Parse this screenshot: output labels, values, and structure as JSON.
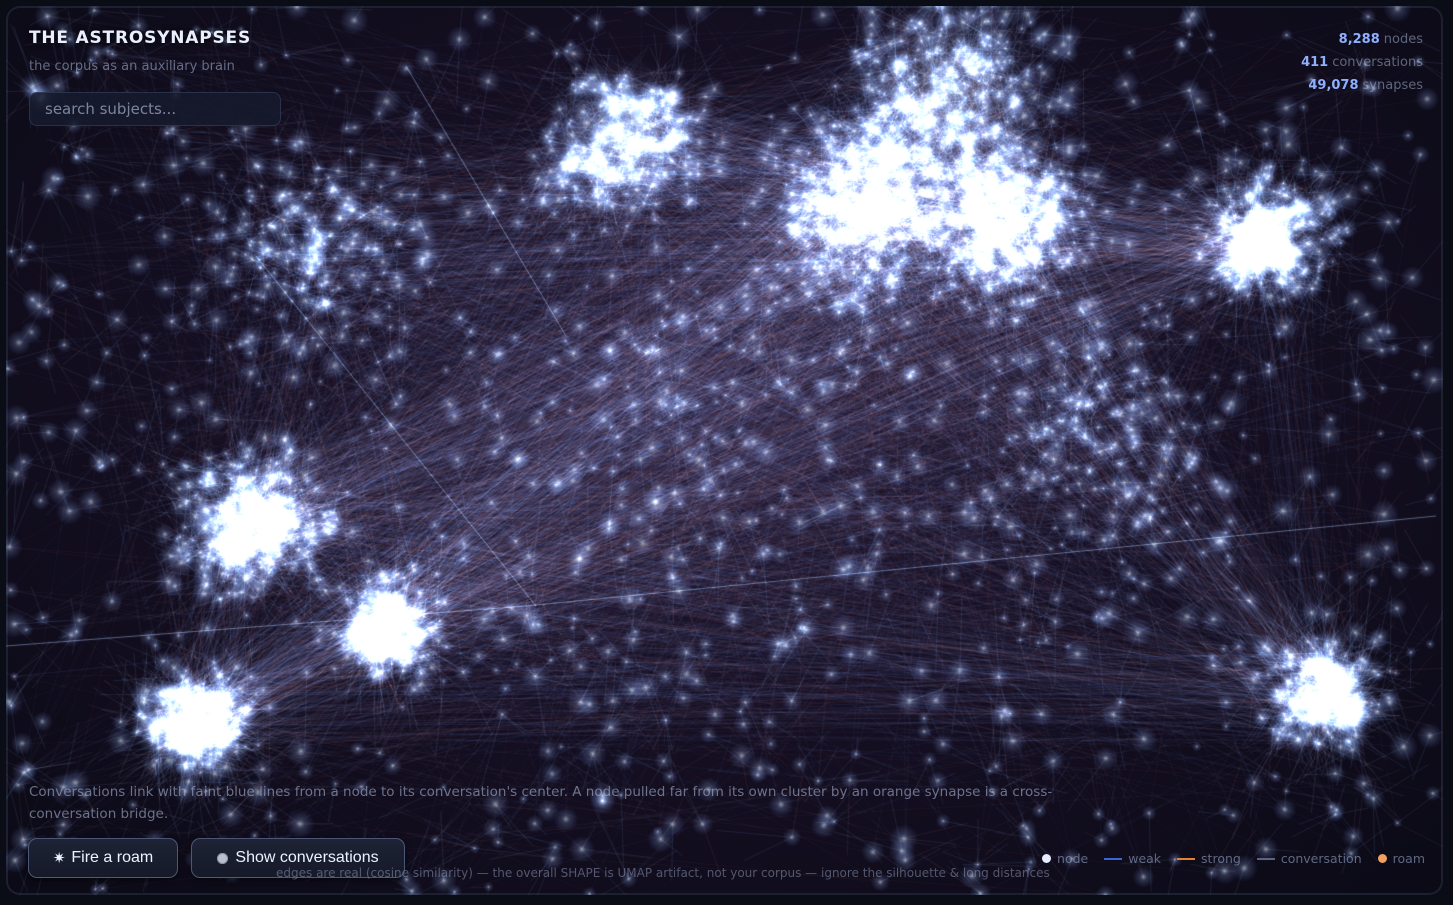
{
  "header": {
    "title": "THE ASTROSYNAPSES",
    "subtitle": "the corpus as an auxiliary brain"
  },
  "search": {
    "placeholder": "search subjects..."
  },
  "stats": {
    "nodes": {
      "value": "8,288",
      "label": "nodes"
    },
    "conversations": {
      "value": "411",
      "label": "conversations"
    },
    "synapses": {
      "value": "49,078",
      "label": "synapses"
    }
  },
  "explainer": {
    "text": "Conversations link with faint blue lines from a node to its conversation's center. A node pulled far from its own cluster by an orange synapse is a cross-conversation bridge."
  },
  "buttons": {
    "roam": {
      "icon": "✷",
      "label": "Fire a roam"
    },
    "conversations": {
      "label": "Show conversations"
    }
  },
  "footnote": {
    "text": "edges are real (cosine similarity) — the overall SHAPE is UMAP artifact, not your corpus — ignore the silhouette & long distances"
  },
  "legend": {
    "items": [
      {
        "key": "node",
        "label": "node",
        "kind": "dot",
        "color": "#e6ecff"
      },
      {
        "key": "weak",
        "label": "weak",
        "kind": "line",
        "color": "#3f63d6"
      },
      {
        "key": "strong",
        "label": "strong",
        "kind": "line",
        "color": "#e0803a"
      },
      {
        "key": "conversation",
        "label": "conversation",
        "kind": "line",
        "color": "#5a6680"
      },
      {
        "key": "roam",
        "label": "roam",
        "kind": "dot",
        "color": "#f0a060"
      }
    ]
  },
  "colors": {
    "edge_blue": "#8fb4ff",
    "edge_red": "#d98a8a",
    "node_glow": "#dbe8ff",
    "background": "#150f22"
  }
}
